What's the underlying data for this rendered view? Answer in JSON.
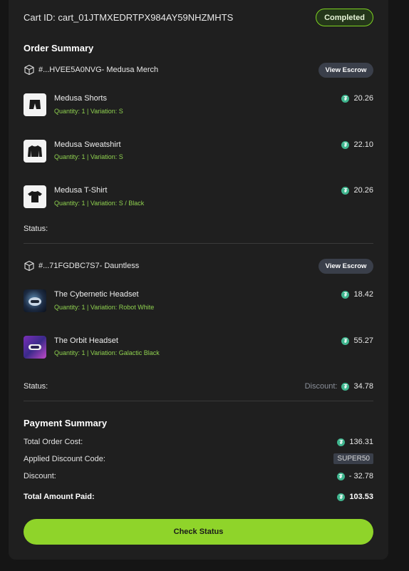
{
  "header": {
    "cart_id": "Cart ID: cart_01JTMXEDRTPX984AY59NHZMHTS",
    "status_badge": "Completed"
  },
  "order_summary": {
    "title": "Order Summary",
    "currency_icon": "tether-coin-icon",
    "orders": [
      {
        "title": "#...HVEE5A0NVG- Medusa Merch",
        "escrow_label": "View Escrow",
        "items": [
          {
            "name": "Medusa Shorts",
            "meta": "Quantity: 1 | Variation: S",
            "price": "20.26",
            "thumb": "shorts-icon"
          },
          {
            "name": "Medusa Sweatshirt",
            "meta": "Quantity: 1 | Variation: S",
            "price": "22.10",
            "thumb": "sweatshirt-icon"
          },
          {
            "name": "Medusa T-Shirt",
            "meta": "Quantity: 1 | Variation: S / Black",
            "price": "20.26",
            "thumb": "tshirt-icon"
          }
        ],
        "status_label": "Status:"
      },
      {
        "title": "#...71FGDBC7S7- Dauntless",
        "escrow_label": "View Escrow",
        "items": [
          {
            "name": "The Cybernetic Headset",
            "meta": "Quantity: 1 | Variation: Robot White",
            "price": "18.42",
            "thumb": "cyber-headset-image"
          },
          {
            "name": "The Orbit Headset",
            "meta": "Quantity: 1 | Variation: Galactic Black",
            "price": "55.27",
            "thumb": "orbit-headset-image"
          }
        ],
        "status_label": "Status:",
        "discount_label": "Discount:",
        "discount_value": "34.78"
      }
    ]
  },
  "payment_summary": {
    "title": "Payment Summary",
    "total_order_cost_label": "Total Order Cost:",
    "total_order_cost": "136.31",
    "discount_code_label": "Applied Discount Code:",
    "discount_code": "SUPER50",
    "discount_label": "Discount:",
    "discount_value": "- 32.78",
    "total_paid_label": "Total Amount Paid:",
    "total_paid": "103.53"
  },
  "actions": {
    "check_status_label": "Check Status"
  },
  "colors": {
    "accent_green": "#8fd42a",
    "coin_teal": "#3fb58e",
    "meta_green": "#8fd14f"
  }
}
